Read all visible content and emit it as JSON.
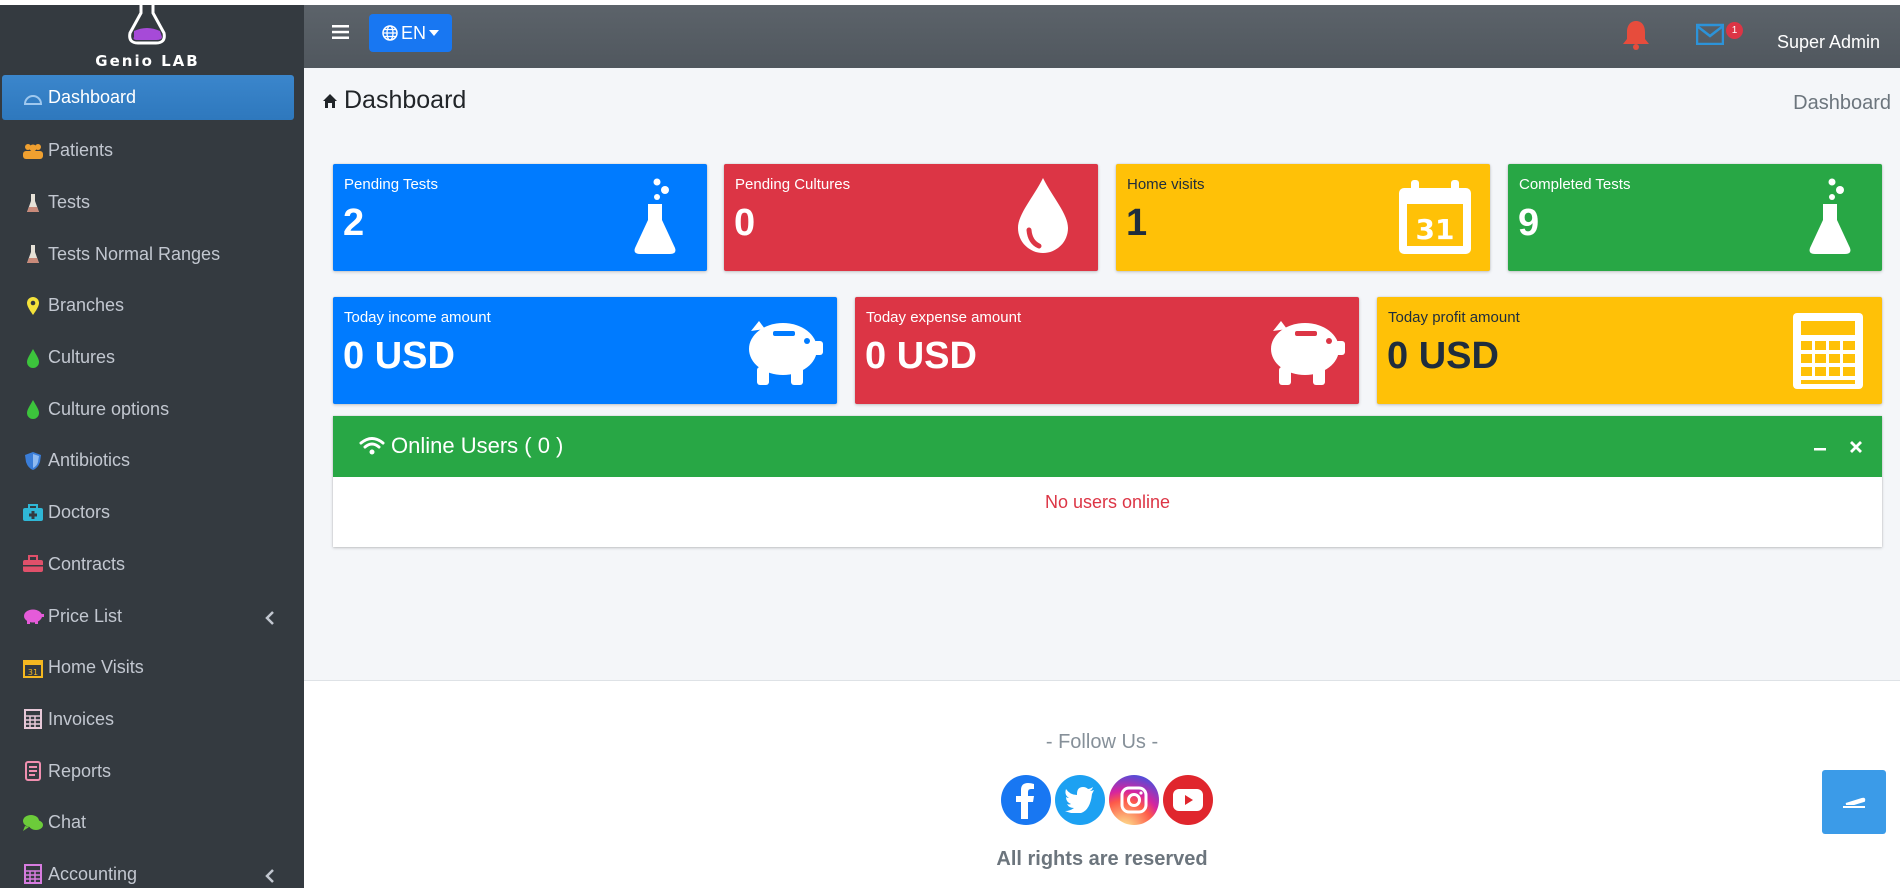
{
  "brand": {
    "name": "Genio LAB"
  },
  "sidebar": {
    "items": [
      {
        "label": "Dashboard",
        "icon": "dashboard-icon"
      },
      {
        "label": "Patients",
        "icon": "users-icon"
      },
      {
        "label": "Tests",
        "icon": "flask-icon"
      },
      {
        "label": "Tests Normal Ranges",
        "icon": "flask-icon"
      },
      {
        "label": "Branches",
        "icon": "map-marker-icon"
      },
      {
        "label": "Cultures",
        "icon": "drop-icon"
      },
      {
        "label": "Culture options",
        "icon": "drop-icon"
      },
      {
        "label": "Antibiotics",
        "icon": "shield-icon"
      },
      {
        "label": "Doctors",
        "icon": "medkit-icon"
      },
      {
        "label": "Contracts",
        "icon": "briefcase-icon"
      },
      {
        "label": "Price List",
        "icon": "piggy-bank-icon"
      },
      {
        "label": "Home Visits",
        "icon": "calendar-icon"
      },
      {
        "label": "Invoices",
        "icon": "calculator-icon"
      },
      {
        "label": "Reports",
        "icon": "report-icon"
      },
      {
        "label": "Chat",
        "icon": "chat-icon"
      },
      {
        "label": "Accounting",
        "icon": "calculator-icon"
      }
    ]
  },
  "navbar": {
    "language": "EN",
    "mail_count": "1",
    "user": "Super Admin"
  },
  "page": {
    "title": "Dashboard",
    "breadcrumb": "Dashboard"
  },
  "stats_row1": [
    {
      "label": "Pending Tests",
      "value": "2",
      "color": "#007bff"
    },
    {
      "label": "Pending Cultures",
      "value": "0",
      "color": "#dc3545"
    },
    {
      "label": "Home visits",
      "value": "1",
      "color": "#ffc107"
    },
    {
      "label": "Completed Tests",
      "value": "9",
      "color": "#28a745"
    }
  ],
  "stats_row2": [
    {
      "label": "Today income amount",
      "value": "0 USD",
      "color": "#007bff"
    },
    {
      "label": "Today expense amount",
      "value": "0 USD",
      "color": "#dc3545"
    },
    {
      "label": "Today profit amount",
      "value": "0 USD",
      "color": "#ffc107"
    }
  ],
  "calendar_day": "31",
  "online_users": {
    "title": "Online Users ( 0 )",
    "empty": "No users online"
  },
  "footer": {
    "follow": "- Follow Us -",
    "rights": "All rights are reserved"
  }
}
